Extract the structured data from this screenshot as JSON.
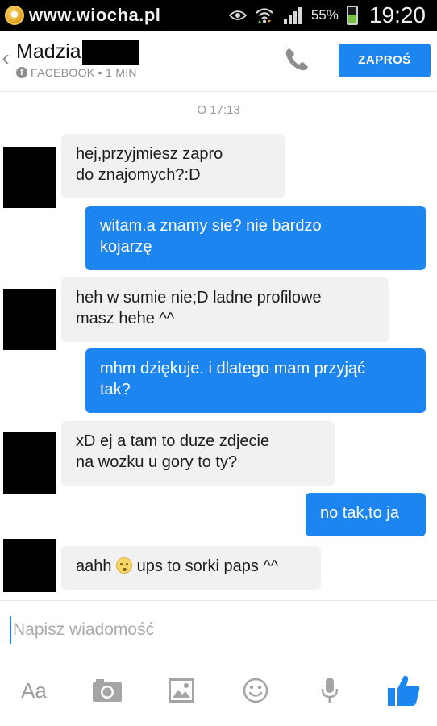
{
  "status_bar": {
    "watermark": "www.wiocha.pl",
    "battery_percent": "55%",
    "battery_level": 0.55,
    "time": "19:20",
    "icons": [
      "eye-icon",
      "wifi-icon",
      "signal-icon",
      "battery-icon"
    ]
  },
  "header": {
    "back_icon": "chevron-left-icon",
    "contact_name": "Madzia",
    "subtitle": "FACEBOOK • 1 MIN",
    "call_icon": "phone-icon",
    "invite_label": "ZAPROŚ"
  },
  "chat": {
    "timestamp": "O 17:13",
    "messages": [
      {
        "direction": "in",
        "line1": "hej,przyjmiesz zapro",
        "line2": "do znajomych?:D"
      },
      {
        "direction": "out",
        "line1": "witam.a znamy sie? nie bardzo",
        "line2": "kojarzę"
      },
      {
        "direction": "in",
        "line1": "heh w sumie nie;D ladne profilowe",
        "line2": "masz hehe ^^"
      },
      {
        "direction": "out",
        "line1": "mhm dziękuje. i dlatego mam przyjąć",
        "line2": "tak?"
      },
      {
        "direction": "in",
        "line1": "xD ej a tam to duze zdjecie",
        "line2": "na wozku u gory to ty?"
      },
      {
        "direction": "out",
        "line1": "no tak,to ja"
      },
      {
        "direction": "in",
        "before_emoji": "aahh",
        "emoji": "astonished-emoji",
        "after_emoji": "ups to sorki paps ^^"
      }
    ]
  },
  "composer": {
    "placeholder": "Napisz wiadomość"
  },
  "toolbar": {
    "text_format_label": "Aa",
    "icons": [
      "camera-icon",
      "image-icon",
      "smiley-icon",
      "microphone-icon",
      "thumbs-up-icon"
    ]
  },
  "colors": {
    "accent": "#1d85f0",
    "incoming_bubble": "#f1f1f1",
    "muted_text": "#9a9a9a"
  }
}
